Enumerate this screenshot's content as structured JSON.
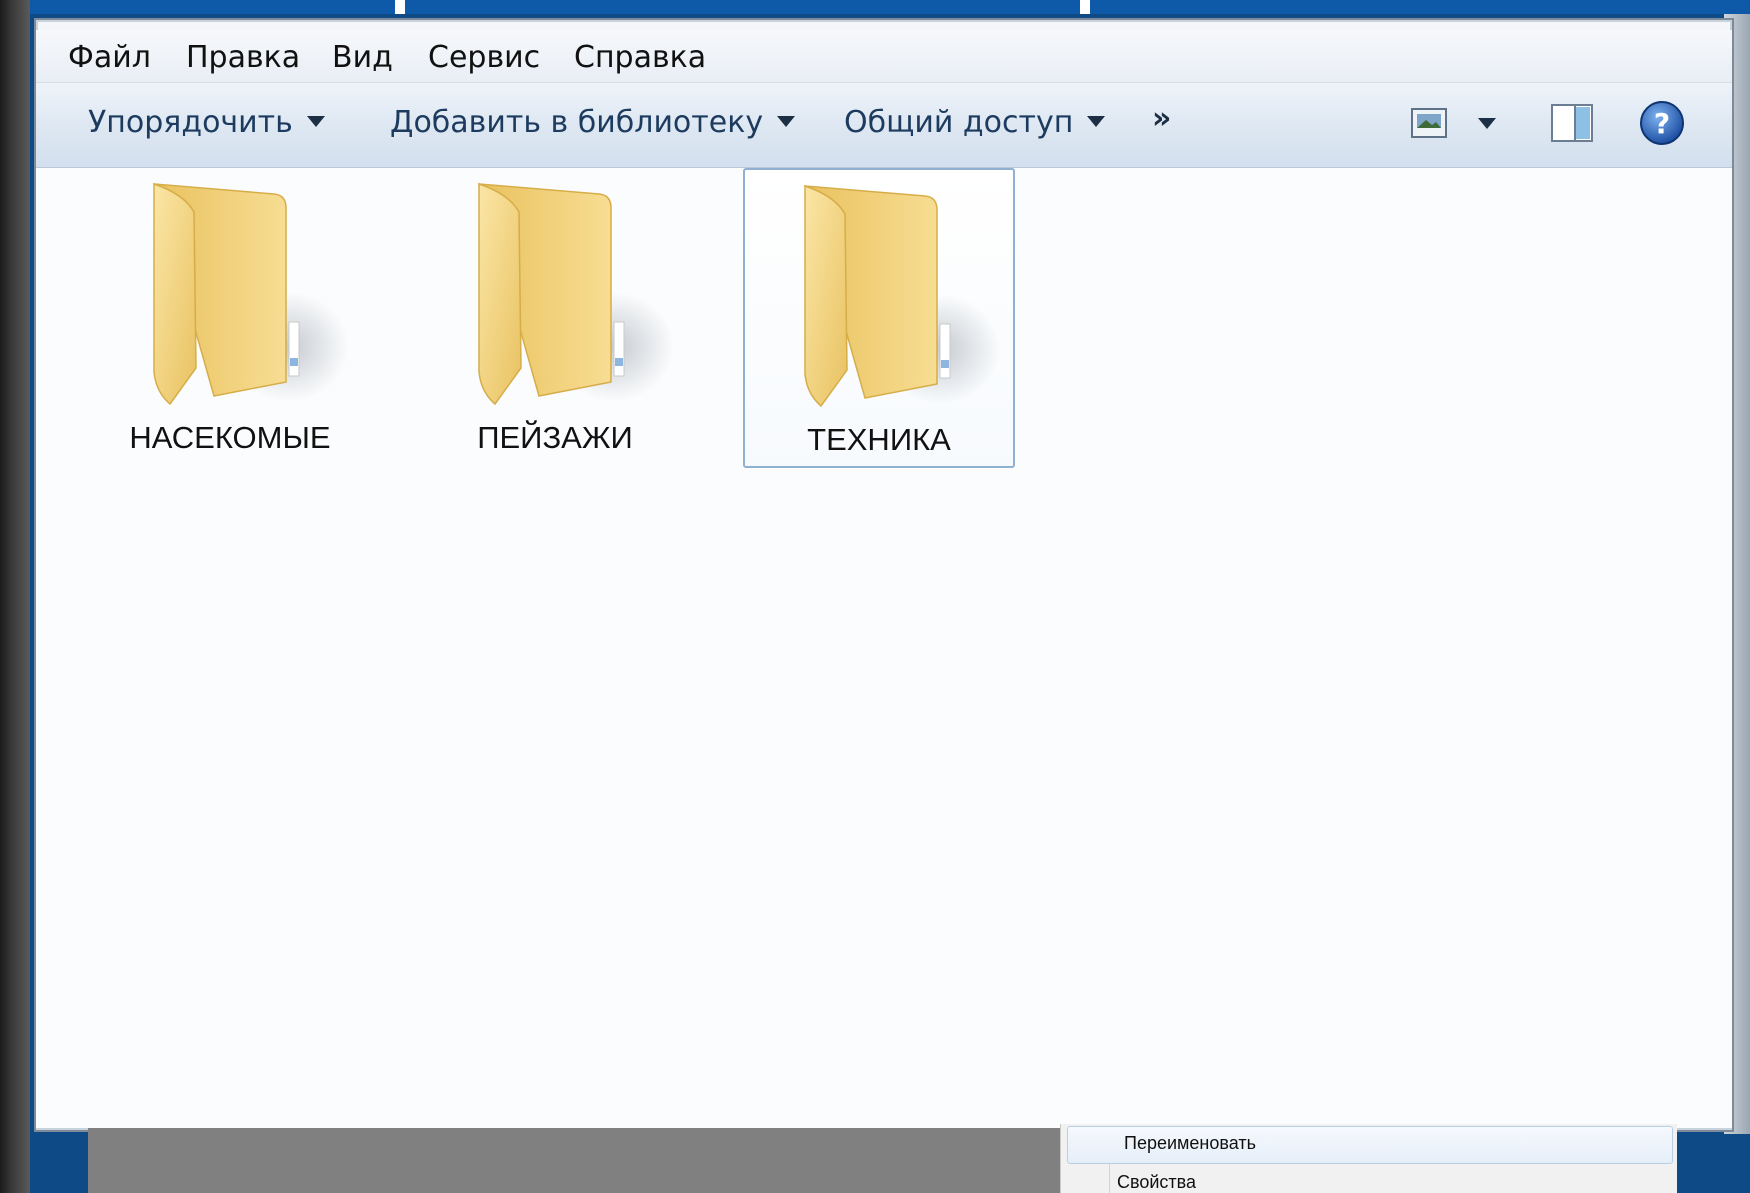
{
  "menubar": {
    "items": [
      "Файл",
      "Правка",
      "Вид",
      "Сервис",
      "Справка"
    ]
  },
  "toolbar": {
    "organize": "Упорядочить",
    "add_to_library": "Добавить в библиотеку",
    "share": "Общий доступ",
    "more": "»",
    "view_icon": "change-view-icon",
    "preview_pane_icon": "preview-pane-icon",
    "help_icon": "help-icon"
  },
  "folders": [
    {
      "name": "НАСЕКОМЫЕ",
      "selected": false
    },
    {
      "name": "ПЕЙЗАЖИ",
      "selected": false
    },
    {
      "name": "ТЕХНИКА",
      "selected": true
    }
  ],
  "context_menu": {
    "items": [
      "Переименовать",
      "Свойства"
    ],
    "highlighted": "Переименовать"
  },
  "colors": {
    "folder": "#f4d27a",
    "selection_border": "#8fb0d1",
    "toolbar_text": "#1c3b5e",
    "desktop": "#0e4a86"
  }
}
